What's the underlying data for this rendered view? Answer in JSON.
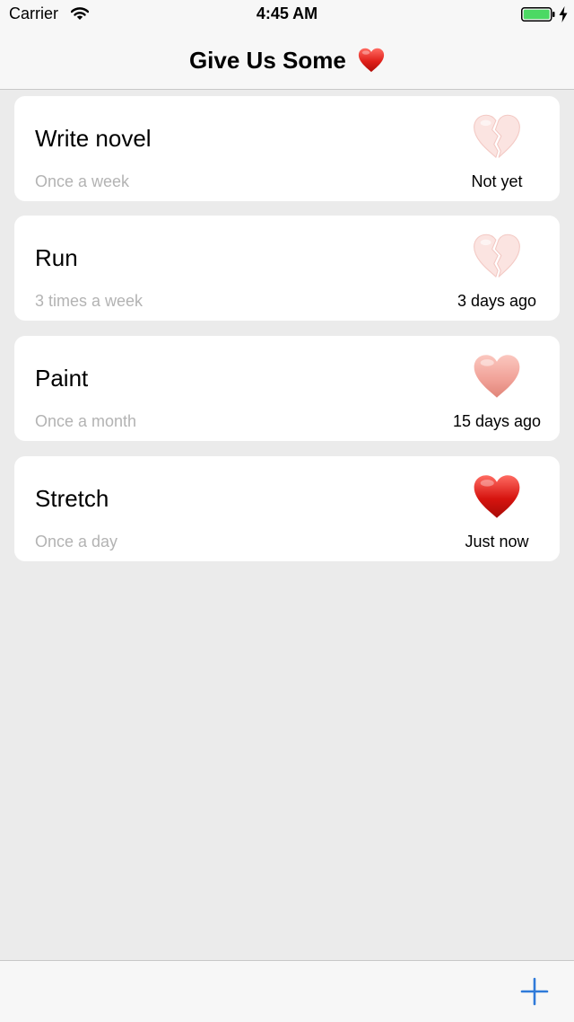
{
  "status_bar": {
    "carrier": "Carrier",
    "time": "4:45 AM",
    "wifi_icon": "wifi-icon",
    "battery_icon": "battery-charging-icon",
    "battery_color": "#4cd964"
  },
  "nav": {
    "title": "Give Us Some",
    "title_icon": "red-heart-icon"
  },
  "habits": [
    {
      "name": "Write novel",
      "frequency": "Once a week",
      "last_done": "Not yet",
      "heart_icon": "broken-heart-icon",
      "heart_color": "#fbe4e1"
    },
    {
      "name": "Run",
      "frequency": "3 times a week",
      "last_done": "3 days ago",
      "heart_icon": "broken-heart-icon",
      "heart_color": "#fbe4e1"
    },
    {
      "name": "Paint",
      "frequency": "Once a month",
      "last_done": "15 days ago",
      "heart_icon": "heart-icon",
      "heart_color": "#f0a096"
    },
    {
      "name": "Stretch",
      "frequency": "Once a day",
      "last_done": "Just now",
      "heart_icon": "heart-icon",
      "heart_color": "#d6140f"
    }
  ],
  "toolbar": {
    "add_icon": "plus-icon",
    "accent_color": "#2f7ad9"
  }
}
